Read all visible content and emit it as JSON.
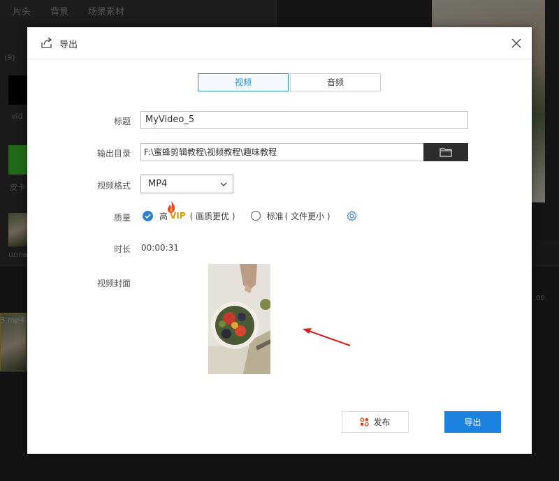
{
  "background": {
    "tabs": [
      "片头",
      "背景",
      "场景素材"
    ],
    "labels": {
      "count": "(9)",
      "video_label": "vid",
      "skin_label": "皮卡",
      "unnamed_label": "unna",
      "track_label": "3.mp4",
      "ruler_tick": ".00"
    }
  },
  "dialog": {
    "title": "导出",
    "tabs": [
      {
        "label": "视频",
        "active": true
      },
      {
        "label": "音频",
        "active": false
      }
    ],
    "fields": {
      "title_label": "标题",
      "title_value": "MyVideo_5",
      "output_dir_label": "输出目录",
      "output_dir_value": "F:\\蜜蜂剪辑教程\\视频教程\\趣味教程",
      "format_label": "视频格式",
      "format_value": "MP4",
      "quality_label": "质量",
      "quality_high": "高",
      "quality_vip": "VIP",
      "quality_high_note": "( 画质更优 )",
      "quality_standard": "标准",
      "quality_standard_note": "( 文件更小 )",
      "duration_label": "时长",
      "duration_value": "00:00:31",
      "cover_label": "视频封面"
    },
    "buttons": {
      "publish": "发布",
      "export": "导出"
    },
    "colors": {
      "accent": "#1c82e0",
      "arrow": "#d32020",
      "vip": "#d89a00"
    }
  }
}
